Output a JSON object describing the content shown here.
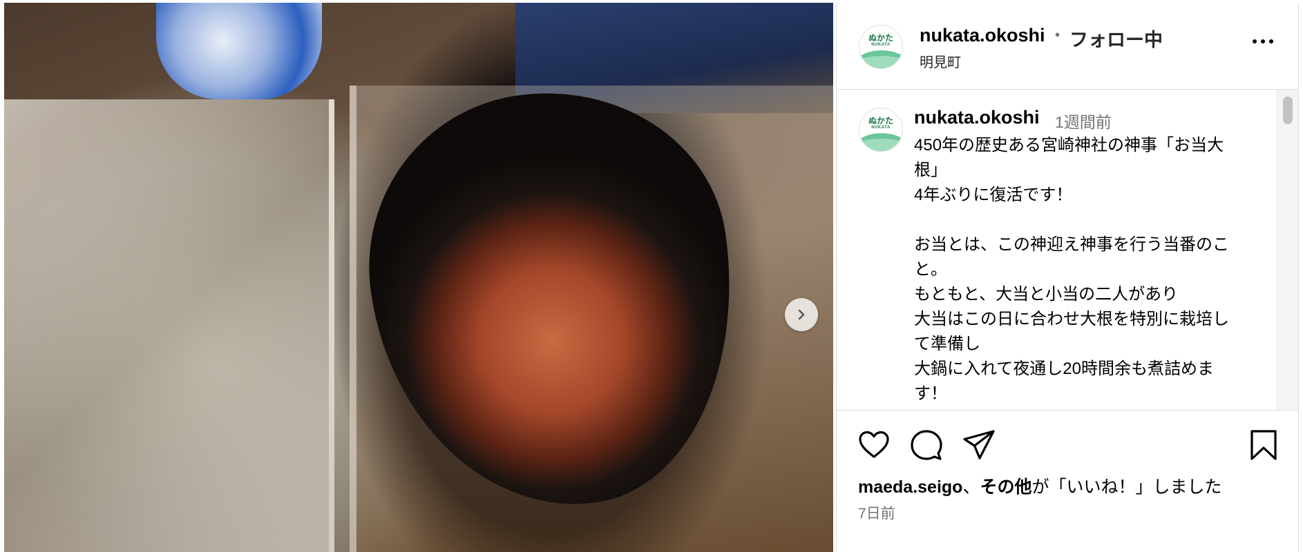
{
  "post": {
    "image_alt": "煮詰めたお当大根"
  },
  "header": {
    "username": "nukata.okoshi",
    "dot": "•",
    "follow_status": "フォロー中",
    "location": "明見町"
  },
  "avatar": {
    "logo_text": "ぬかた",
    "logo_sub": "NUKATA"
  },
  "caption": {
    "username": "nukata.okoshi",
    "time": "1週間前",
    "lines": [
      "450年の歴史ある宮崎神社の神事「お当大",
      "根」",
      "4年ぶりに復活です！",
      "",
      "お当とは、この神迎え神事を行う当番のこ",
      "と。",
      "もともと、大当と小当の二人があり",
      "大当はこの日に合わせ大根を特別に栽培し",
      "て準備し",
      "大鍋に入れて夜通し20時間余も煮詰めま",
      "す！"
    ]
  },
  "likes": {
    "liker": "maeda.seigo",
    "sep": "、",
    "others": "その他",
    "suffix": "が「いいね！」しました"
  },
  "date": "7日前",
  "icons": {
    "like": "heart-icon",
    "comment": "comment-icon",
    "share": "share-icon",
    "save": "bookmark-icon",
    "more": "more-icon",
    "next": "chevron-right-icon"
  }
}
